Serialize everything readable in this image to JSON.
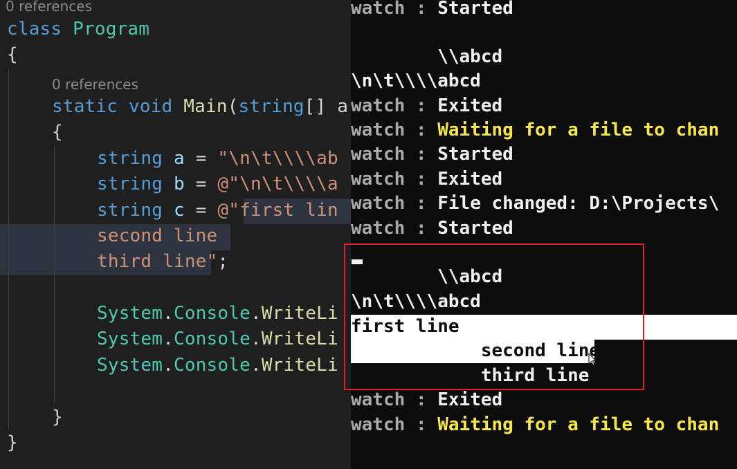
{
  "editor": {
    "lens_class": "0 references",
    "lens_main": "0 references",
    "lines": {
      "class_kw": "class",
      "class_name": "Program",
      "open_brace": "{",
      "static_kw": "static",
      "void_kw": "void",
      "main_name": "Main",
      "main_paren": "(",
      "string_kw_param": "string",
      "param_rest": "[] a",
      "inner_open": "{",
      "a_type": "string",
      "a_name": "a",
      "a_eq": " = ",
      "a_val": "\"\\n\\t\\\\\\\\ab",
      "b_type": "string",
      "b_name": "b",
      "b_eq": " = ",
      "b_val": "@\"\\n\\t\\\\\\\\a",
      "c_type": "string",
      "c_name": "c",
      "c_eq": " = ",
      "c_val": "@\"first lin",
      "second_line": "second line",
      "third_line": "third line",
      "third_end_quote": "\"",
      "third_semicolon": ";",
      "console_cls_1": "System",
      "console_dot_1": ".",
      "console_name_1": "Console",
      "console_dot_1b": ".",
      "console_fn_1": "WriteLi",
      "console_cls_2": "System",
      "console_dot_2": ".",
      "console_name_2": "Console",
      "console_dot_2b": ".",
      "console_fn_2": "WriteLi",
      "console_cls_3": "System",
      "console_dot_3": ".",
      "console_name_3": "Console",
      "console_dot_3b": ".",
      "console_fn_3": "WriteLi",
      "inner_close": "}",
      "outer_close": "}"
    }
  },
  "console": {
    "l0_prefix": "watch : ",
    "l0_msg": "Started",
    "l1": "        \\\\abcd",
    "l2": "\\n\\t\\\\\\\\abcd",
    "l3_prefix": "watch : ",
    "l3_msg": "Exited",
    "l4_prefix": "watch : ",
    "l4_msg": "Waiting for a file to chan",
    "l5_prefix": "watch : ",
    "l5_msg": "Started",
    "l6_prefix": "watch : ",
    "l6_msg": "Exited",
    "l7_prefix": "watch : ",
    "l7_msg": "File changed: D:\\Projects\\",
    "l8_prefix": "watch : ",
    "l8_msg": "Started",
    "l9": "        \\\\abcd",
    "l10": "\\n\\t\\\\\\\\abcd",
    "l11": "first line",
    "l12": "            second line",
    "l13": "            third line",
    "l14_prefix": "watch : ",
    "l14_msg": "Exited",
    "l15_prefix": "watch : ",
    "l15_msg": "Waiting for a file to chan"
  },
  "colors": {
    "editor_bg": "#1f1f1f",
    "console_bg": "#0c0c0c",
    "highlight_box": "#e0212b",
    "watch_prefix": "#a9a9a9",
    "watch_warning": "#f6e84a"
  }
}
